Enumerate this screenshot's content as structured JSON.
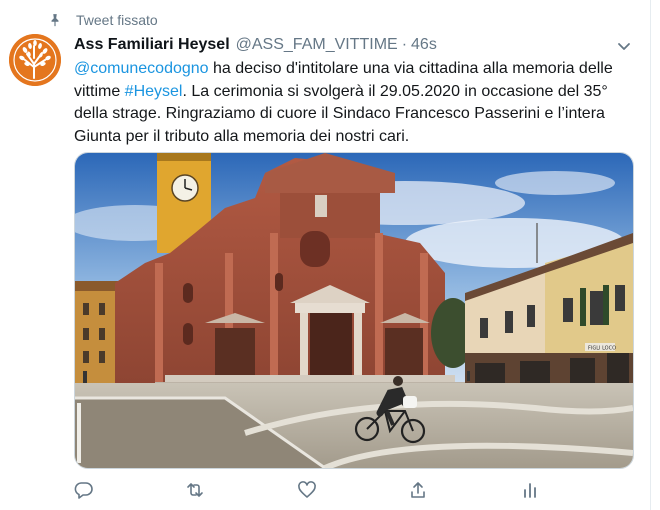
{
  "pinned_label": "Tweet fissato",
  "author": {
    "name": "Ass Familiari Heysel",
    "handle": "@ASS_FAM_VITTIME",
    "separator": "·",
    "time": "46s"
  },
  "tweet": {
    "mention": "@comunecodogno",
    "text_1": " ha deciso d'intitolare una via cittadina alla memoria delle vittime ",
    "hashtag": "#Heysel",
    "text_2": ". La cerimonia si svolgerà il 29.05.2020 in occasione del 35° della strage. Ringraziamo di cuore il Sindaco Francesco Passerini e l’intera Giunta per il tributo alla memoria dei nostri cari."
  },
  "media": {
    "clock_sign": "",
    "shop_sign": "FIGLI LOCO"
  },
  "icons": {
    "pin": "pin-icon",
    "more": "chevron-down-icon",
    "reply": "reply-icon",
    "retweet": "retweet-icon",
    "like": "like-icon",
    "share": "share-icon",
    "analytics": "analytics-icon"
  },
  "colors": {
    "link": "#1b95e0",
    "secondary_text": "#657786",
    "avatar_bg": "#e4761e"
  }
}
